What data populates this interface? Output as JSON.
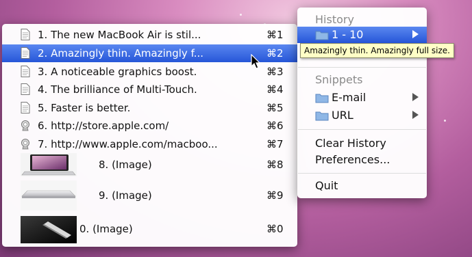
{
  "history_menu": {
    "items": [
      {
        "label": "1. The new MacBook Air is stil...",
        "shortcut": "⌘1",
        "icon": "document-icon"
      },
      {
        "label": "2. Amazingly thin. Amazingly f...",
        "shortcut": "⌘2",
        "icon": "document-icon",
        "selected": true
      },
      {
        "label": "3. A noticeable graphics boost.",
        "shortcut": "⌘3",
        "icon": "document-icon"
      },
      {
        "label": "4. The brilliance of Multi-Touch.",
        "shortcut": "⌘4",
        "icon": "document-icon"
      },
      {
        "label": "5. Faster is better.",
        "shortcut": "⌘5",
        "icon": "document-icon"
      },
      {
        "label": "6. http://store.apple.com/",
        "shortcut": "⌘6",
        "icon": "webloc-icon"
      },
      {
        "label": "7. http://www.apple.com/macboo...",
        "shortcut": "⌘7",
        "icon": "webloc-icon"
      }
    ],
    "image_items": [
      {
        "label": "8. (Image)",
        "shortcut": "⌘8",
        "icon": "macbook-open-thumbnail"
      },
      {
        "label": "9. (Image)",
        "shortcut": "⌘9",
        "icon": "macbook-closed-thumbnail"
      },
      {
        "label": "0. (Image)",
        "shortcut": "⌘0",
        "icon": "macbook-dark-thumbnail"
      }
    ]
  },
  "tray_menu": {
    "history_header": "History",
    "range_item": "1 - 10",
    "snippets_header": "Snippets",
    "email_item": "E-mail",
    "url_item": "URL",
    "clear_history": "Clear History",
    "preferences": "Preferences...",
    "quit": "Quit"
  },
  "tooltip": "Amazingly thin. Amazingly full size.",
  "colors": {
    "selection": "#2f5fe0",
    "tooltip_bg": "#ffffc6",
    "header_text": "#8a8a8a"
  }
}
